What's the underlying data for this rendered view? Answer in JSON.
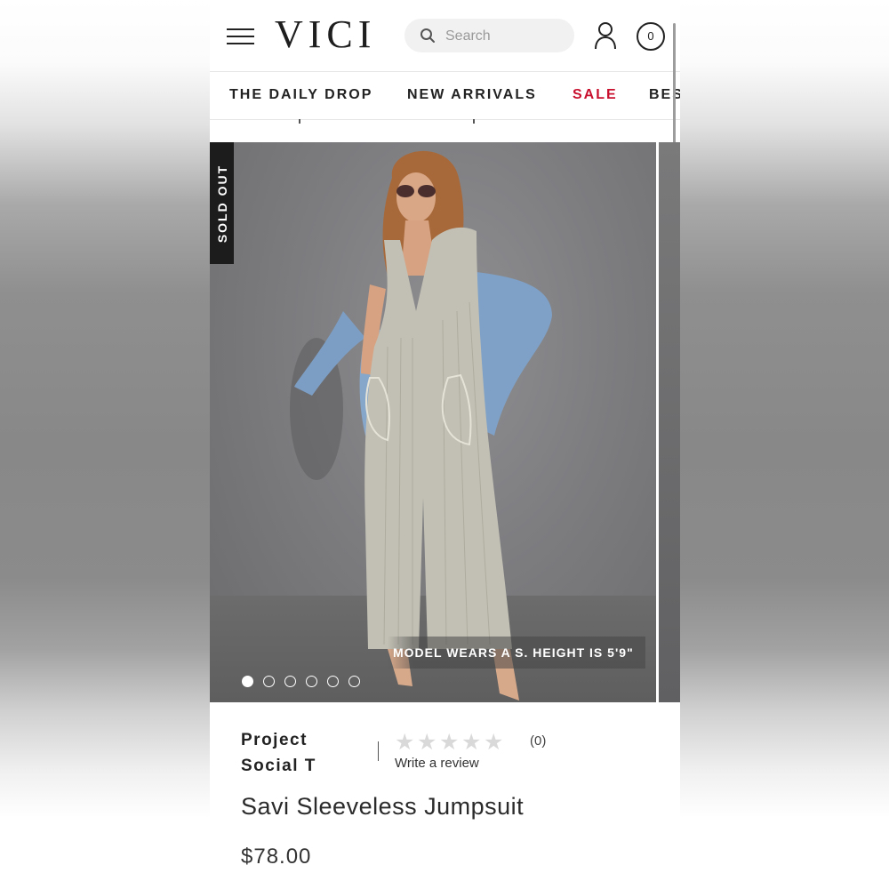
{
  "header": {
    "logo": "VICI",
    "search_placeholder": "Search",
    "cart_count": "0"
  },
  "nav": {
    "items": [
      {
        "label": "THE DAILY DROP"
      },
      {
        "label": "NEW ARRIVALS"
      },
      {
        "label": "SALE"
      },
      {
        "label": "BES"
      }
    ],
    "sale_color": "#c8102e"
  },
  "gallery": {
    "badge": "SOLD OUT",
    "model_note": "MODEL WEARS A S. HEIGHT IS 5'9\"",
    "slide_count": 6,
    "active_slide": 1
  },
  "product": {
    "brand": "Project Social T",
    "rating_stars": 0,
    "rating_max": 5,
    "review_count": "(0)",
    "write_review": "Write a review",
    "title": "Savi Sleeveless Jumpsuit",
    "price": "$78.00"
  }
}
